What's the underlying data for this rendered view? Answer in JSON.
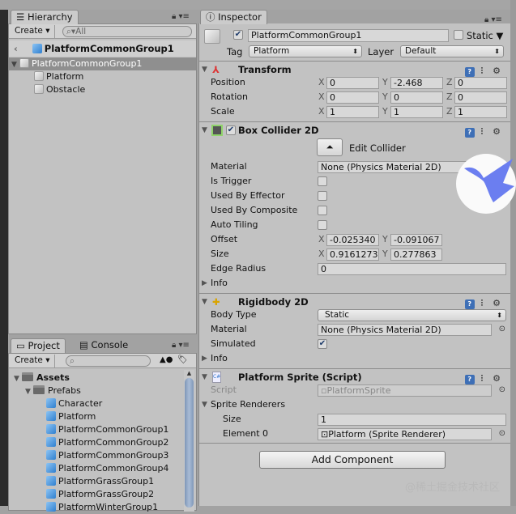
{
  "hierarchy": {
    "tab": "Hierarchy",
    "create": "Create",
    "search_placeholder": "All",
    "prefab_root": "PlatformCommonGroup1",
    "items": [
      {
        "label": "PlatformCommonGroup1"
      },
      {
        "label": "Platform"
      },
      {
        "label": "Obstacle"
      }
    ]
  },
  "inspector": {
    "tab": "Inspector",
    "object_name": "PlatformCommonGroup1",
    "static_label": "Static",
    "tag_label": "Tag",
    "tag_value": "Platform",
    "layer_label": "Layer",
    "layer_value": "Default",
    "transform": {
      "title": "Transform",
      "rows": [
        {
          "label": "Position",
          "x": "0",
          "y": "-2.468",
          "z": "0"
        },
        {
          "label": "Rotation",
          "x": "0",
          "y": "0",
          "z": "0"
        },
        {
          "label": "Scale",
          "x": "1",
          "y": "1",
          "z": "1"
        }
      ]
    },
    "box_collider": {
      "title": "Box Collider 2D",
      "edit_collider": "Edit Collider",
      "material_label": "Material",
      "material_value": "None (Physics Material 2D)",
      "checks": [
        {
          "label": "Is Trigger",
          "checked": false
        },
        {
          "label": "Used By Effector",
          "checked": false
        },
        {
          "label": "Used By Composite",
          "checked": false
        },
        {
          "label": "Auto Tiling",
          "checked": false
        }
      ],
      "offset_label": "Offset",
      "offset_x": "-0.025340",
      "offset_y": "-0.091067",
      "size_label": "Size",
      "size_x": "0.9161273",
      "size_y": "0.277863",
      "edge_radius_label": "Edge Radius",
      "edge_radius": "0",
      "info": "Info"
    },
    "rigidbody": {
      "title": "Rigidbody 2D",
      "body_type_label": "Body Type",
      "body_type": "Static",
      "material_label": "Material",
      "material_value": "None (Physics Material 2D)",
      "simulated_label": "Simulated",
      "simulated": true,
      "info": "Info"
    },
    "script": {
      "title": "Platform Sprite (Script)",
      "script_label": "Script",
      "script_value": "PlatformSprite",
      "renderers_label": "Sprite Renderers",
      "size_label": "Size",
      "size_value": "1",
      "element_label": "Element 0",
      "element_value": "Platform (Sprite Renderer)"
    },
    "add_component": "Add Component",
    "axis": {
      "x": "X",
      "y": "Y",
      "z": "Z"
    }
  },
  "project": {
    "tabs": [
      "Project",
      "Console"
    ],
    "create": "Create",
    "assets": "Assets",
    "prefabs": "Prefabs",
    "items": [
      "Character",
      "Platform",
      "PlatformCommonGroup1",
      "PlatformCommonGroup2",
      "PlatformCommonGroup3",
      "PlatformCommonGroup4",
      "PlatformGrassGroup1",
      "PlatformGrassGroup2",
      "PlatformWinterGroup1"
    ]
  },
  "watermark": "@稀土掘金技术社区"
}
